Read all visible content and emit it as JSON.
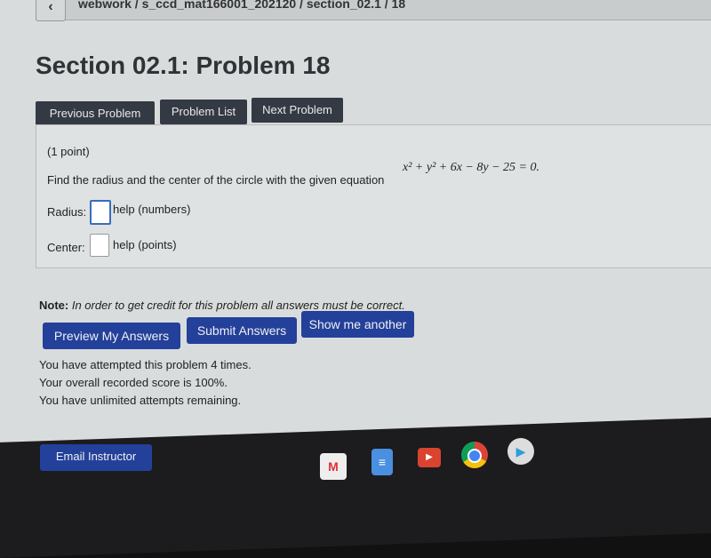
{
  "breadcrumb": "webwork / s_ccd_mat166001_202120 / section_02.1 / 18",
  "title": "Section 02.1: Problem 18",
  "nav": {
    "previous": "Previous Problem",
    "list": "Problem List",
    "next": "Next Problem"
  },
  "problem": {
    "points": "(1 point)",
    "text": "Find the radius and the center of the circle with the given equation",
    "equation": "x² + y² + 6x − 8y − 25 = 0.",
    "radius_label": "Radius:",
    "radius_help": "help (numbers)",
    "radius_value": "",
    "center_label": "Center:",
    "center_help": "help (points)",
    "center_value": ""
  },
  "note": {
    "label": "Note:",
    "text": "In order to get credit for this problem all answers must be correct."
  },
  "actions": {
    "preview": "Preview My Answers",
    "submit": "Submit Answers",
    "another": "Show me another"
  },
  "status": [
    "You have attempted this problem 4 times.",
    "Your overall recorded score is 100%.",
    "You have unlimited attempts remaining."
  ],
  "email": "Email Instructor",
  "shelf": {
    "apps": [
      "gmail-icon",
      "docs-icon",
      "youtube-icon",
      "chrome-icon",
      "play-store-icon"
    ]
  }
}
